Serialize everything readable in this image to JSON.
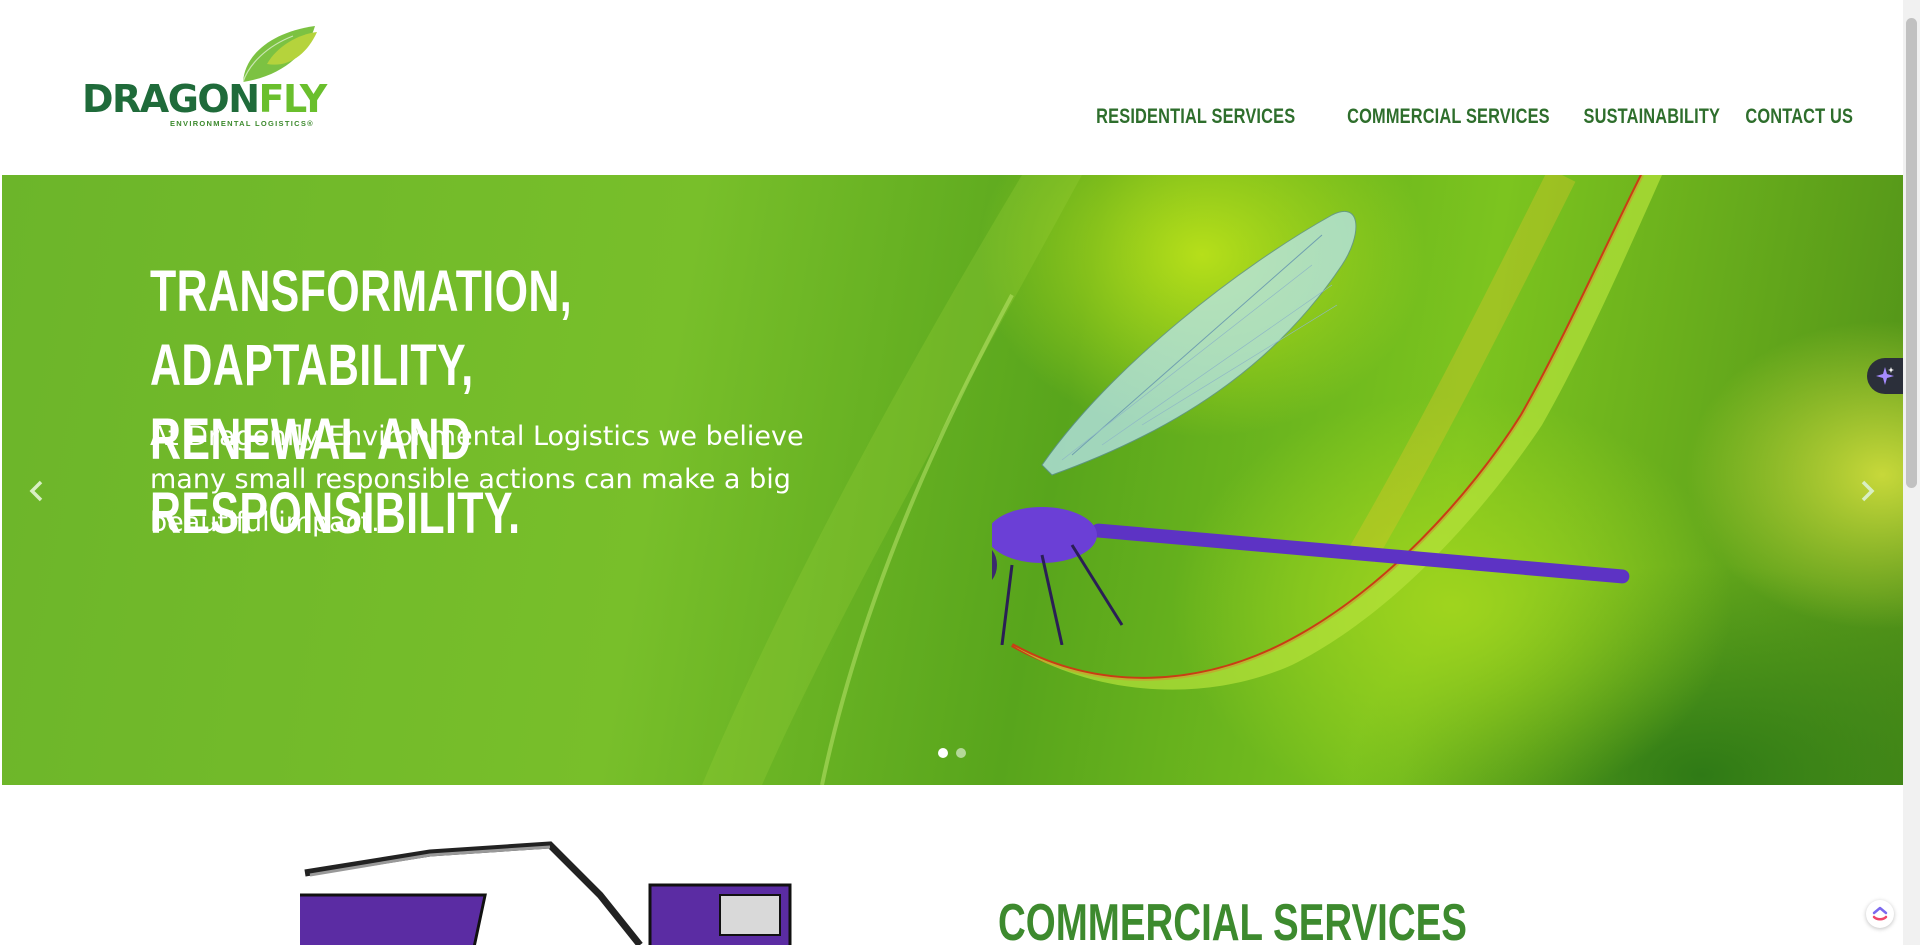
{
  "brand": {
    "name_part1": "DRAGON",
    "name_part2": "FLY",
    "tagline": "ENVIRONMENTAL LOGISTICS®",
    "colors": {
      "dark_green": "#1f6b3a",
      "light_green": "#6abf2d",
      "nav_green": "#2e6e2c"
    }
  },
  "nav": {
    "items": [
      {
        "label": "RESIDENTIAL SERVICES"
      },
      {
        "label": "COMMERCIAL SERVICES"
      },
      {
        "label": "SUSTAINABILITY"
      },
      {
        "label": "CONTACT US"
      }
    ]
  },
  "hero": {
    "title_line1": "TRANSFORMATION, ADAPTABILITY,",
    "title_line2": "RENEWAL AND RESPONSIBILITY.",
    "subtitle": "At Dragonfly Environmental Logistics we believe many small responsible actions can make a big beautiful impact.",
    "prev_icon": "chevron-left-icon",
    "next_icon": "chevron-right-icon",
    "slides": {
      "count": 2,
      "active": 1
    }
  },
  "section": {
    "title": "COMMERCIAL SERVICES"
  },
  "widgets": {
    "ai_icon": "sparkle-icon",
    "helper_icon": "clickup-icon"
  }
}
